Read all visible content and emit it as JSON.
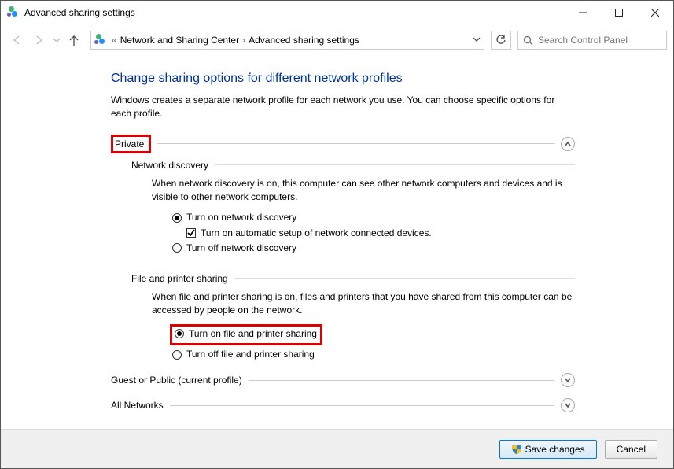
{
  "window": {
    "title": "Advanced sharing settings"
  },
  "breadcrumb": {
    "prefix": "«",
    "item1": "Network and Sharing Center",
    "item2": "Advanced sharing settings"
  },
  "search": {
    "placeholder": "Search Control Panel"
  },
  "page": {
    "title": "Change sharing options for different network profiles",
    "desc": "Windows creates a separate network profile for each network you use. You can choose specific options for each profile."
  },
  "private": {
    "label": "Private",
    "discovery": {
      "title": "Network discovery",
      "desc": "When network discovery is on, this computer can see other network computers and devices and is visible to other network computers.",
      "opt_on": "Turn on network discovery",
      "auto_setup": "Turn on automatic setup of network connected devices.",
      "opt_off": "Turn off network discovery"
    },
    "fps": {
      "title": "File and printer sharing",
      "desc": "When file and printer sharing is on, files and printers that you have shared from this computer can be accessed by people on the network.",
      "opt_on": "Turn on file and printer sharing",
      "opt_off": "Turn off file and printer sharing"
    }
  },
  "guest": {
    "label": "Guest or Public (current profile)"
  },
  "all": {
    "label": "All Networks"
  },
  "footer": {
    "save": "Save changes",
    "cancel": "Cancel"
  }
}
